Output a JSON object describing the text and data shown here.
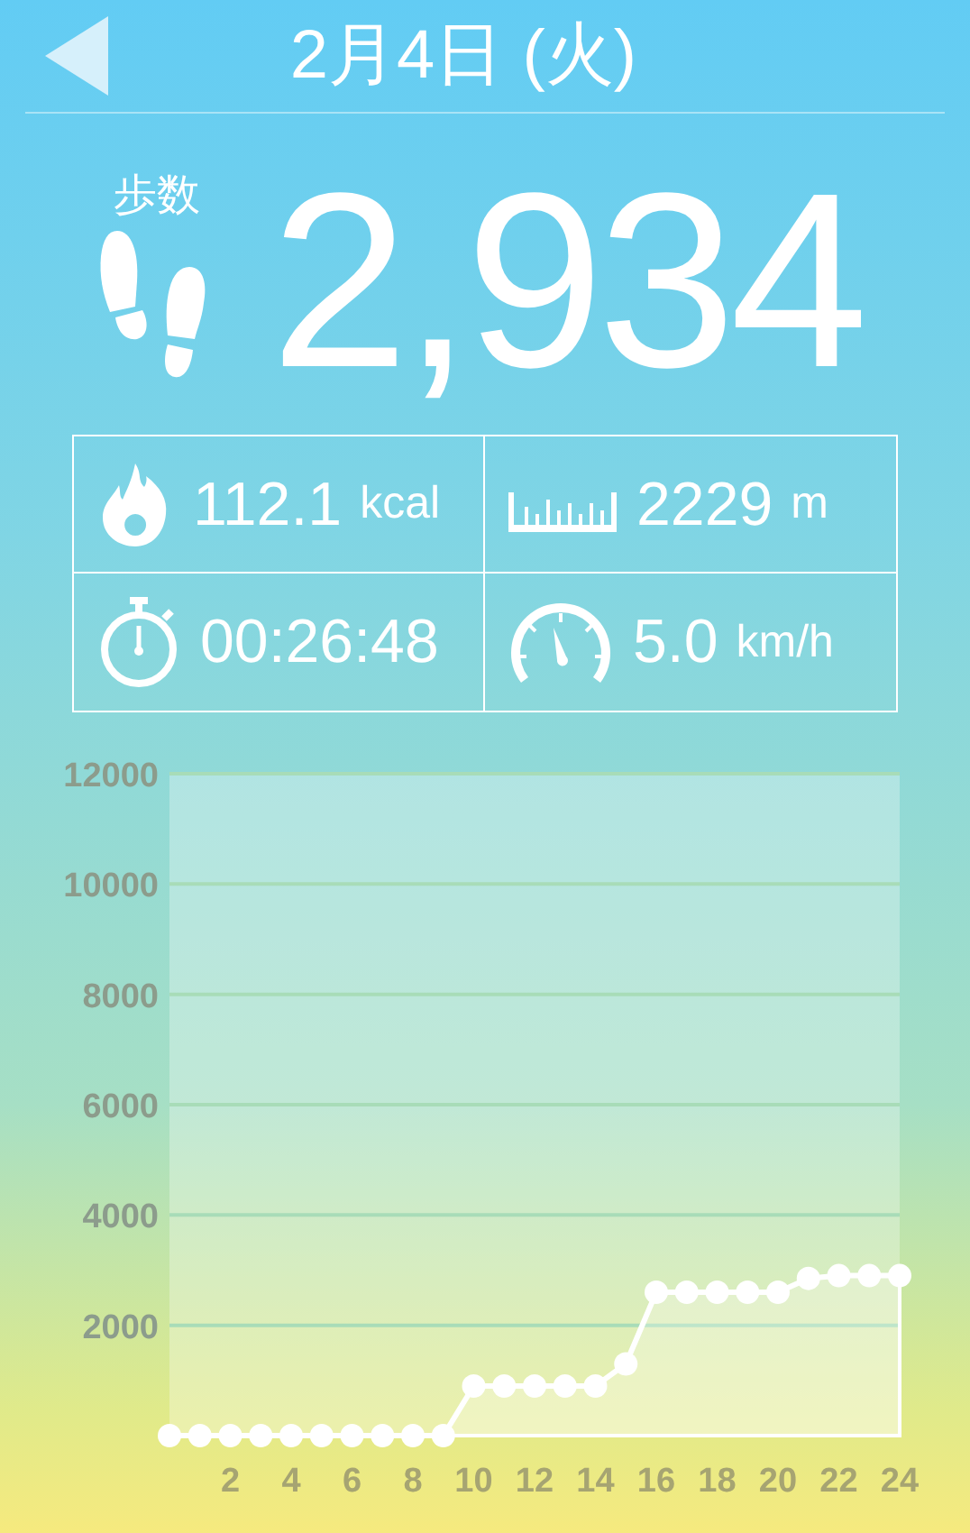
{
  "header": {
    "title": "2月4日 (火)"
  },
  "steps": {
    "label": "歩数",
    "value": "2,934"
  },
  "stats": [
    {
      "kind": "calories",
      "value": "112.1",
      "unit": "kcal"
    },
    {
      "kind": "distance",
      "value": "2229",
      "unit": "m"
    },
    {
      "kind": "time",
      "value": "00:26:48"
    },
    {
      "kind": "speed",
      "value": "5.0",
      "unit": "km/h"
    }
  ],
  "chart": {
    "chart_data": {
      "type": "area",
      "x": [
        0,
        1,
        2,
        3,
        4,
        5,
        6,
        7,
        8,
        9,
        10,
        11,
        12,
        13,
        14,
        15,
        16,
        17,
        18,
        19,
        20,
        21,
        22,
        23,
        24
      ],
      "series": [
        {
          "color": "#ffffff",
          "values": [
            0,
            0,
            0,
            0,
            0,
            0,
            0,
            0,
            0,
            0,
            900,
            900,
            900,
            900,
            900,
            1300,
            2600,
            2600,
            2600,
            2600,
            2600,
            2850,
            2900,
            2900,
            2900
          ]
        }
      ],
      "grid": true,
      "xlim": [
        0,
        24
      ],
      "ylim": [
        0,
        12000
      ],
      "xticks": [
        2,
        4,
        6,
        8,
        10,
        12,
        14,
        16,
        18,
        20,
        22,
        24
      ],
      "yticks": [
        2000,
        4000,
        6000,
        8000,
        10000,
        12000
      ]
    }
  }
}
